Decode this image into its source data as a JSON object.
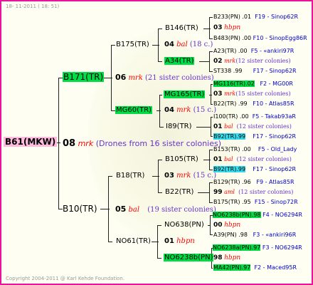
{
  "header": "18- 11-2011 ( 18: 51)",
  "footer": "Copyright 2004-2011 @ Karl Kehde Foundation.",
  "root": {
    "label": "B61(MKW)"
  },
  "gen1": [
    {
      "id": "B171(TR)"
    },
    {
      "num": "08",
      "race": "mrk",
      "note": "(Drones from 16 sister colonies)"
    },
    {
      "id": "B10(TR)"
    }
  ],
  "gen2": [
    {
      "id": "B175(TR)"
    },
    {
      "num": "06",
      "race": "mrk",
      "note": "(21 sister colonies)"
    },
    {
      "id": "MG60(TR)"
    },
    {
      "id": "B18(TR)"
    },
    {
      "num": "05",
      "race": "bal",
      "note": "(19 sister colonies)"
    },
    {
      "id": "NO61(TR)"
    }
  ],
  "gen3": [
    {
      "id": "B146(TR)"
    },
    {
      "num": "04",
      "race": "bal",
      "note": "(18 c.)"
    },
    {
      "id": "A34(TR)"
    },
    {
      "id": "MG165(TR)"
    },
    {
      "num": "04",
      "race": "mrk",
      "note": "(15 c.)"
    },
    {
      "id": "I89(TR)"
    },
    {
      "id": "B105(TR)"
    },
    {
      "num": "03",
      "race": "mrk",
      "note": "(15 c.)"
    },
    {
      "id": "B22(TR)"
    },
    {
      "id": "NO638(PN)"
    },
    {
      "num": "01",
      "race": "hbpn"
    },
    {
      "id": "NO6238b(PN)"
    }
  ],
  "gen4": [
    {
      "parent": "B233(PN)",
      "v": ".01",
      "ref": "F19 - Sinop62R"
    },
    {
      "num": "03",
      "race": "hbpn"
    },
    {
      "parent": "B483(PN)",
      "v": ".00",
      "ref": "F10 - SinopEgg86R"
    },
    {
      "parent": "A23(TR)",
      "v": ".00",
      "ref": "F5 - «ankiri97R"
    },
    {
      "num": "02",
      "race": "mrk",
      "note": "(12 sister colonies)"
    },
    {
      "parent": "ST338",
      "v": ".99",
      "ref": "F17 - Sinop62R"
    },
    {
      "parent": "MG116(TR)",
      "v": ".02",
      "ref": "F2 - MG00R"
    },
    {
      "num": "03",
      "race": "mrk",
      "note": "(15 sister colonies)"
    },
    {
      "parent": "B22(TR)",
      "v": ".99",
      "ref": "F10 - Atlas85R"
    },
    {
      "parent": "I100(TR)",
      "v": ".00",
      "ref": "F5 - Takab93aR"
    },
    {
      "num": "01",
      "race": "bal",
      "note": "(12 sister colonies)"
    },
    {
      "parent": "B92(TR)",
      "v": ".99",
      "ref": "F17 - Sinop62R"
    },
    {
      "parent": "B153(TR)",
      "v": ".00",
      "ref": "F5 - Old_Lady"
    },
    {
      "num": "01",
      "race": "bal",
      "note": "(12 sister colonies)"
    },
    {
      "parent": "B92(TR)",
      "v": ".99",
      "ref": "F17 - Sinop62R"
    },
    {
      "parent": "B129(TR)",
      "v": ".96",
      "ref": "F9 - Atlas85R"
    },
    {
      "num": "99",
      "race": "aml",
      "note": "(12 sister colonies)"
    },
    {
      "parent": "B175(TR)",
      "v": ".95",
      "ref": "F15 - Sinop72R"
    },
    {
      "parent": "NO6238b(PN)",
      "v": ".98",
      "ref": "F4 - NO6294R"
    },
    {
      "num": "00",
      "race": "hbpn"
    },
    {
      "parent": "A39(PN)",
      "v": ".98",
      "ref": "F3 - «ankiri96R"
    },
    {
      "parent": "NO6238a(PN)",
      "v": ".97",
      "ref": "F3 - NO6294R"
    },
    {
      "num": "98",
      "race": "hbpn"
    },
    {
      "parent": "MA42(PN)",
      "v": ".97",
      "ref": "F2 - Maced95R"
    }
  ],
  "colors": {
    "border": "#e8159a",
    "green": "#00dd44",
    "cyan": "#33ddee",
    "pink": "#ffbbdd",
    "race": "#ff0000",
    "note": "#6633cc",
    "ref": "#0000c0"
  }
}
